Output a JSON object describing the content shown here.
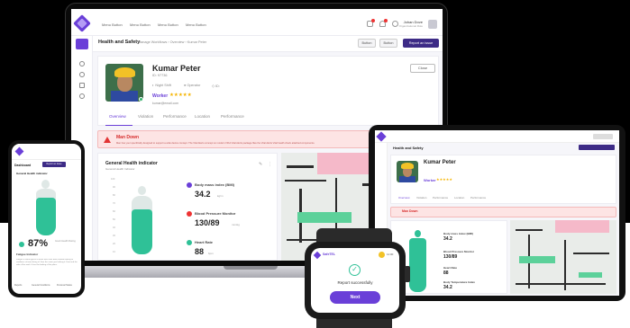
{
  "colors": {
    "brand": "#6a3fd8",
    "navy": "#3d2b86",
    "danger": "#d62b2b",
    "health": "#2fc197"
  },
  "laptop": {
    "menu": [
      "Menu Button",
      "Menu Button",
      "Menu Button",
      "Menu Button"
    ],
    "user": {
      "name": "Johan Dove",
      "role": "Organizational Role"
    },
    "page_title": "Health and Safety",
    "breadcrumb": "Manage Workflows  ›  Overview  ›  Kumar Peter",
    "buttons": {
      "b1": "Button",
      "b2": "Button",
      "report": "Report an issue"
    },
    "profile": {
      "name": "Kumar Peter",
      "id": "ID: 97736",
      "shift": "Night Shift",
      "operator": "Operator",
      "site": "ID:",
      "role": "Worker",
      "stars": "★★★★★",
      "email": "kumar@email.com",
      "close": "Close"
    },
    "tabs": [
      "Overview",
      "Violation",
      "Performance",
      "Location",
      "Performance"
    ],
    "alert": {
      "title": "Man Down",
      "text": "Man has your specifically designed to support a wide device concept. The Vital Alerts concept on modern VIKA Vital Alerts package files the Vital Alerts Vital health check attached components."
    },
    "health": {
      "title": "General Health indicator",
      "subtitle": "General Health Indicator",
      "yticks": [
        "100",
        "90",
        "80",
        "70",
        "60",
        "50",
        "40",
        "30",
        "20",
        "10"
      ],
      "metrics": [
        {
          "label": "Body mass index (BMI)",
          "value": "34.2",
          "unit": "kg/m"
        },
        {
          "label": "Blood Pressure Monitor",
          "value": "130/89",
          "unit": "mmHg"
        },
        {
          "label": "Heart Rate",
          "value": "88",
          "unit": "bpm"
        }
      ]
    }
  },
  "tablet": {
    "page_title": "Health and Safety",
    "profile_name": "Kumar Peter",
    "role": "Worker",
    "stars": "★★★★★",
    "tabs": [
      "Overview",
      "Violation",
      "Performance",
      "Location",
      "Performance"
    ],
    "alert_title": "Man Down",
    "metrics": [
      {
        "label": "Body mass index (BMI)",
        "value": "34.2"
      },
      {
        "label": "Blood Pressure Monitor",
        "value": "130/89"
      },
      {
        "label": "Heart Rate",
        "value": "88"
      },
      {
        "label": "Body Temperature Index",
        "value": "34.2"
      }
    ]
  },
  "phone": {
    "title": "Dashboard",
    "report": "Report an Issue",
    "health_title": "General Health indicator",
    "percent": "87%",
    "percent_label": "Good Health Rating",
    "fatigue": "Fatigue Indicator",
    "note": "Fatigue is more typical of those who have been trained looking at readiness at team being of. Item the same you looking it. Feet and the side of the work. It has the looking of the plans.",
    "footer": [
      "Reports",
      "General Conditions",
      "Personal Status"
    ]
  },
  "watch": {
    "app": "SafeTEL",
    "time": "11:00",
    "message": "Report successfully",
    "next": "Next"
  }
}
